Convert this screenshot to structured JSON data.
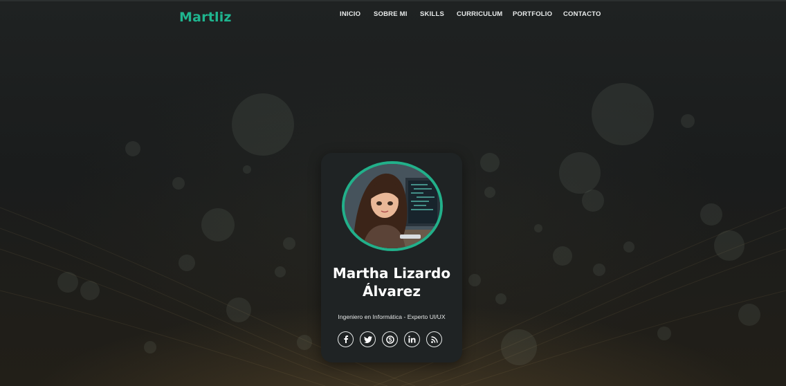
{
  "brand": {
    "logo": "Martliz",
    "accent": "#1fb58f"
  },
  "nav": {
    "items": [
      {
        "label": "INICIO"
      },
      {
        "label": "SOBRE MI"
      },
      {
        "label": "SKILLS"
      },
      {
        "label": "CURRICULUM"
      },
      {
        "label": "PORTFOLIO"
      },
      {
        "label": "CONTACTO"
      }
    ]
  },
  "profile": {
    "name_line1": "Martha Lizardo",
    "name_line2": "Álvarez",
    "subtitle": "Ingeniero en Informática - Experto UI/UX",
    "social_icons": [
      "facebook-icon",
      "twitter-icon",
      "skype-icon",
      "linkedin-icon",
      "rss-icon"
    ]
  }
}
